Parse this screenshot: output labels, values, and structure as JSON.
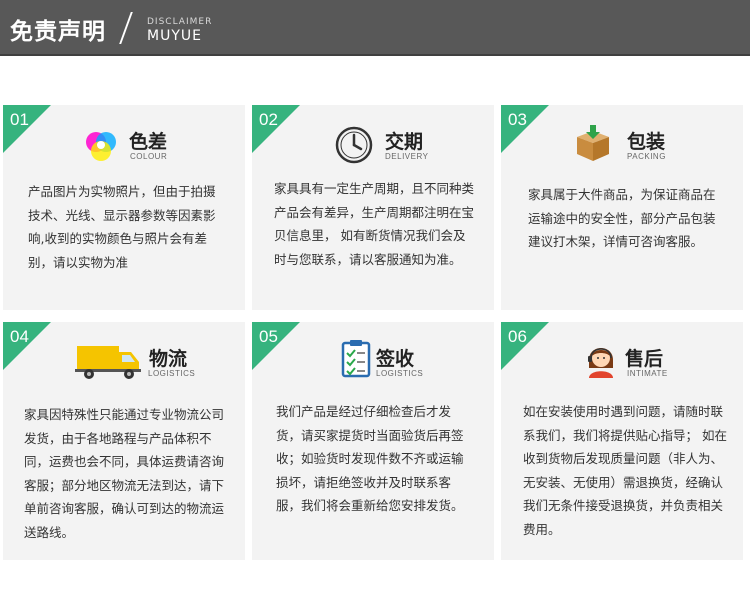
{
  "header": {
    "title": "免责声明",
    "en_small": "DISCLAIMER",
    "en_big": "MUYUE"
  },
  "cards": [
    {
      "num": "01",
      "title": "色差",
      "subtitle": "COLOUR",
      "icon": "color-wheel-icon",
      "body": "产品图片为实物照片，但由于拍摄技术、光线、显示器参数等因素影响,收到的实物颜色与照片会有差别，请以实物为准"
    },
    {
      "num": "02",
      "title": "交期",
      "subtitle": "DELIVERY",
      "icon": "clock-icon",
      "body": "家具具有一定生产周期，且不同种类产品会有差异，生产周期都注明在宝贝信息里， 如有断货情况我们会及时与您联系，请以客服通知为准。"
    },
    {
      "num": "03",
      "title": "包装",
      "subtitle": "PACKING",
      "icon": "box-icon",
      "body": "家具属于大件商品，为保证商品在运输途中的安全性，部分产品包装建议打木架，详情可咨询客服。"
    },
    {
      "num": "04",
      "title": "物流",
      "subtitle": "LOGISTICS",
      "icon": "truck-icon",
      "body": "家具因特殊性只能通过专业物流公司发货，由于各地路程与产品体积不同，运费也会不同，具体运费请咨询客服；部分地区物流无法到达，请下单前咨询客服，确认可到达的物流运送路线。"
    },
    {
      "num": "05",
      "title": "签收",
      "subtitle": "LOGISTICS",
      "icon": "checklist-icon",
      "body": "我们产品是经过仔细检查后才发货，请买家提货时当面验货后再签收；如验货时发现件数不齐或运输损坏，请拒绝签收并及时联系客服，我们将会重新给您安排发货。"
    },
    {
      "num": "06",
      "title": "售后",
      "subtitle": "INTIMATE",
      "icon": "customer-service-icon",
      "body": "如在安装使用时遇到问题，请随时联系我们，我们将提供贴心指导； 如在收到货物后发现质量问题（非人为、无安装、无使用）需退换货，经确认我们无条件接受退换货，并负责相关费用。"
    }
  ],
  "colors": {
    "header_bg": "#585858",
    "accent_green": "#36b37e",
    "card_bg": "#f3f3f3"
  }
}
